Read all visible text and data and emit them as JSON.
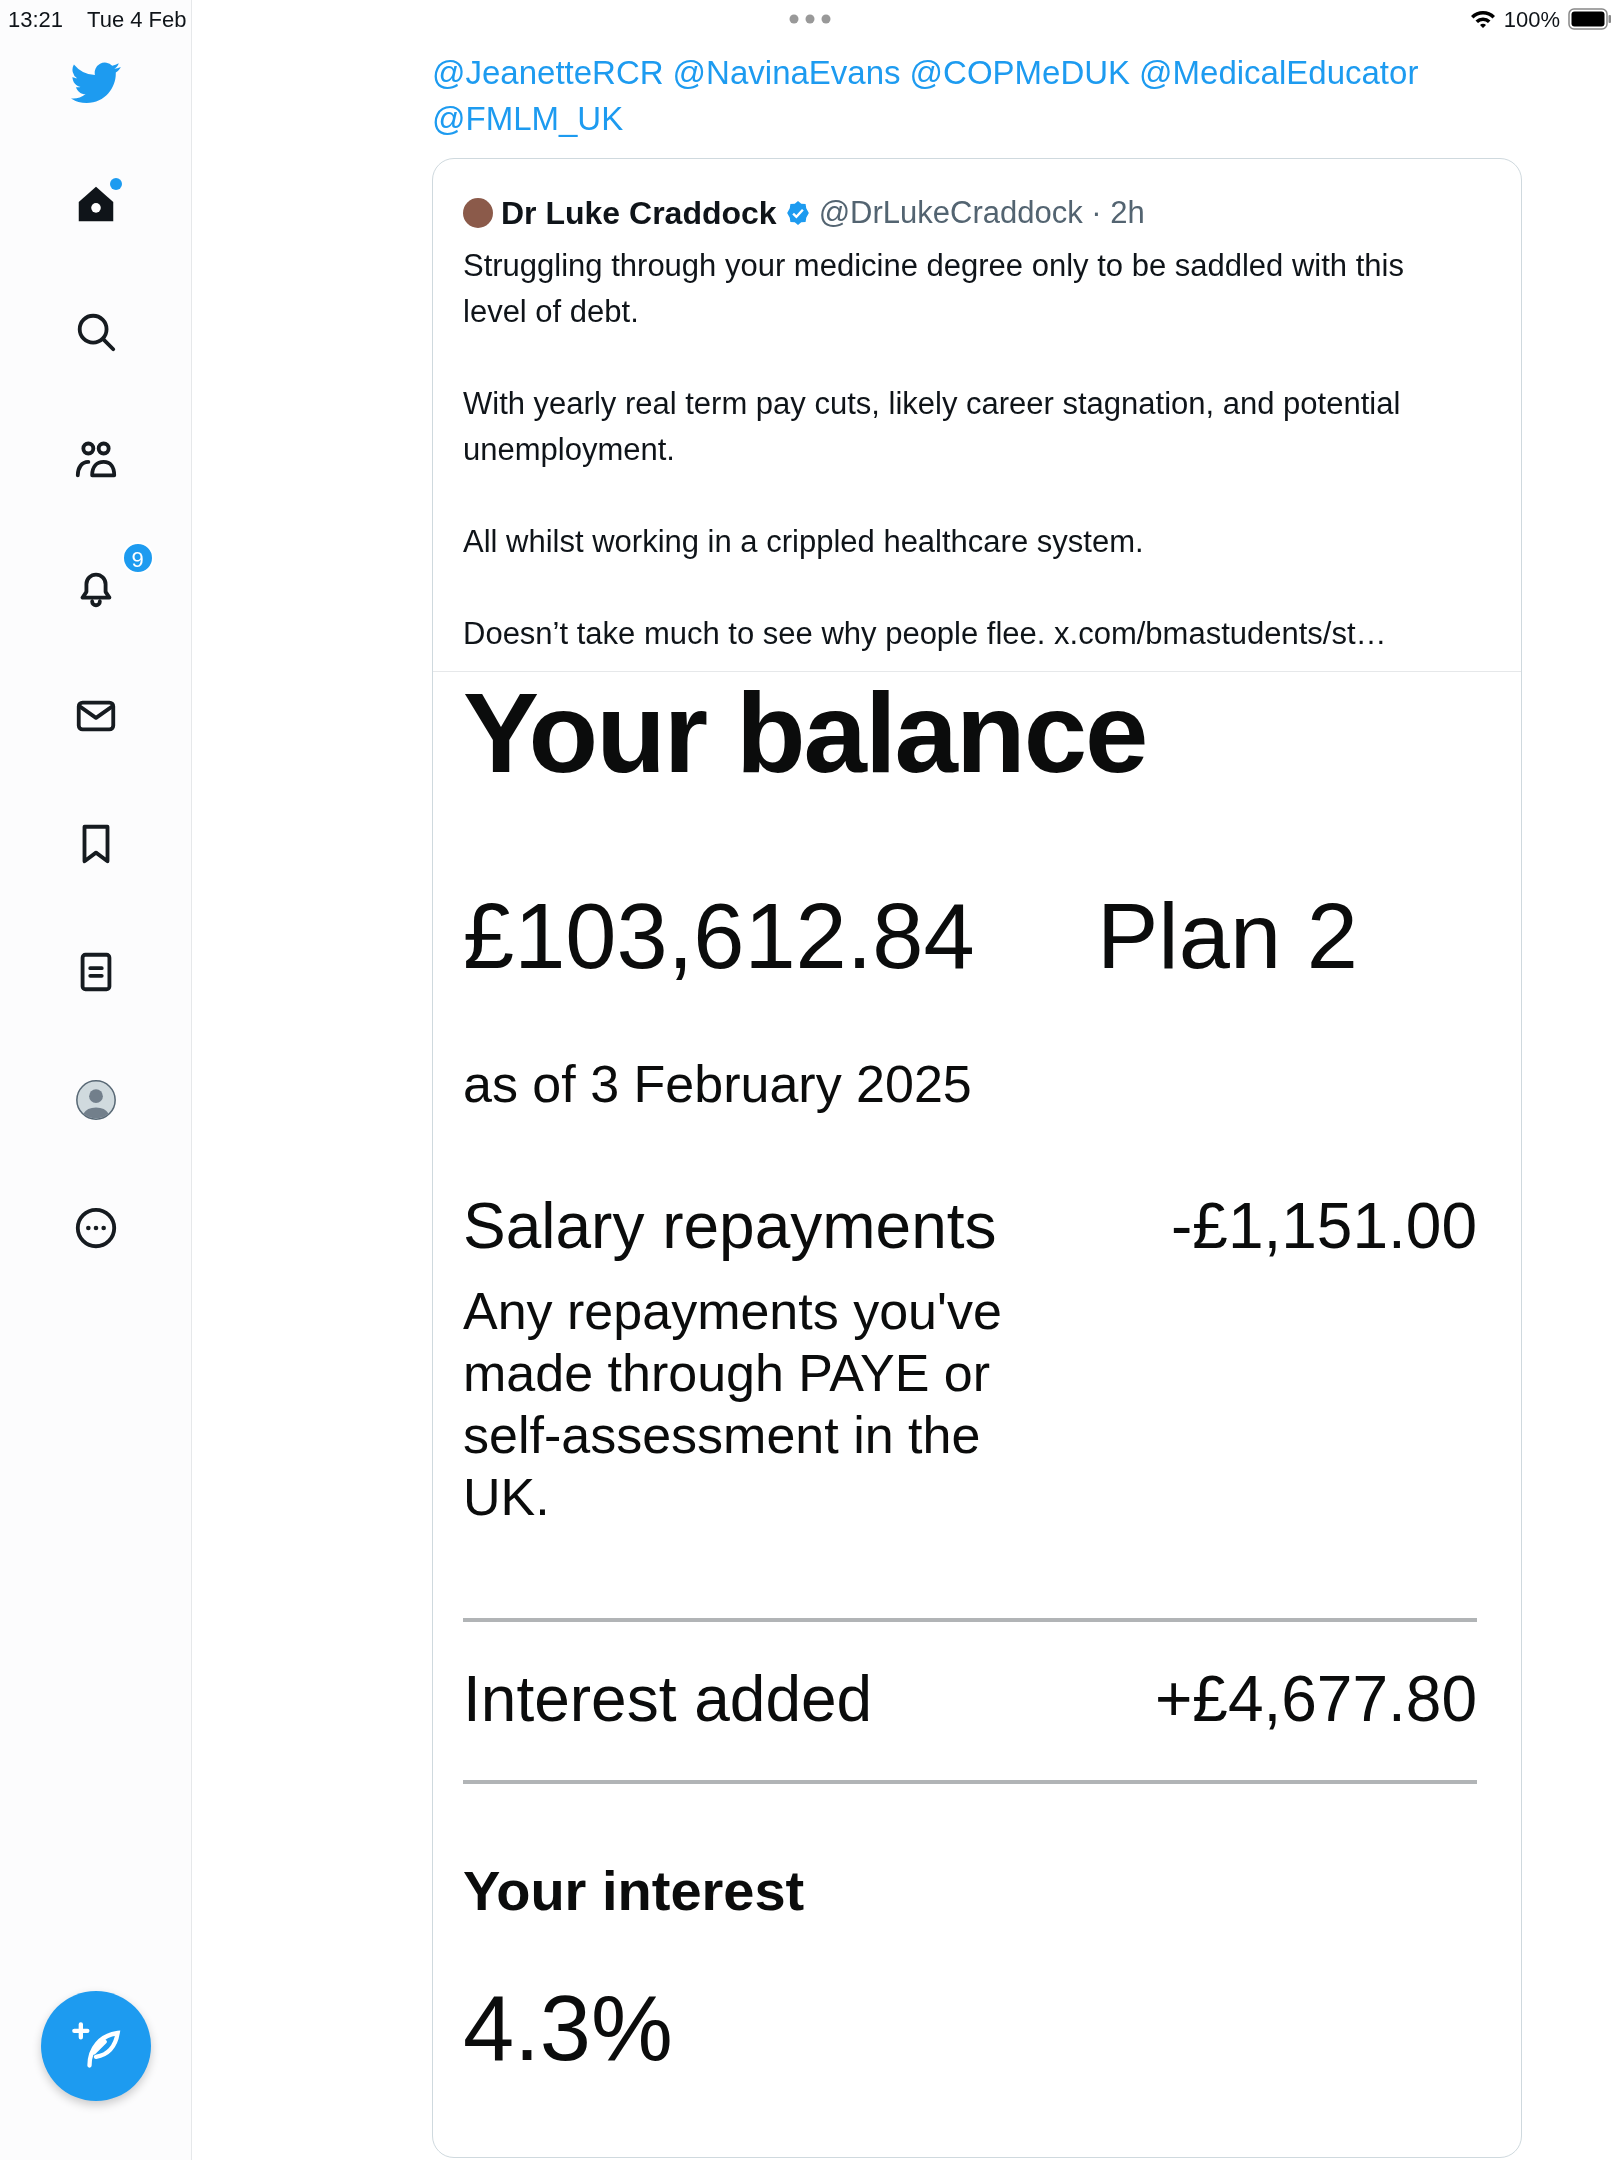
{
  "status_bar": {
    "time": "13:21",
    "date": "Tue 4 Feb",
    "battery": "100%"
  },
  "sidebar": {
    "items": [
      {
        "kind": "home",
        "selected": true,
        "dot": true
      },
      {
        "kind": "search",
        "selected": false
      },
      {
        "kind": "people",
        "selected": false
      },
      {
        "kind": "bell",
        "selected": false,
        "badge": "9"
      },
      {
        "kind": "mail",
        "selected": false
      },
      {
        "kind": "bookmark",
        "selected": false
      },
      {
        "kind": "list",
        "selected": false
      },
      {
        "kind": "profile",
        "selected": false
      },
      {
        "kind": "more",
        "selected": false
      }
    ]
  },
  "reply_to": [
    "@JeanetteRCR",
    "@NavinaEvans",
    "@COPMeDUK",
    "@MedicalEducator",
    "@FMLM_UK"
  ],
  "quoted_tweet": {
    "author": "Dr Luke Craddock",
    "verified": true,
    "handle": "@DrLukeCraddock",
    "time": "· 2h",
    "paragraphs": [
      "Struggling through your medicine degree only to be saddled with this level of debt.",
      "With yearly real term pay cuts, likely career stagnation, and potential unemployment.",
      "All whilst working in a crippled healthcare system.",
      "Doesn’t take much to see why people flee. x.com/bmastudents/st…"
    ],
    "image": {
      "title": "Your balance",
      "balance": "£103,612.84",
      "plan": "Plan 2",
      "as_of": "as of 3 February 2025",
      "repayments_label": "Salary repayments",
      "repayments_value": "-£1,151.00",
      "repayments_note": "Any repayments you've made through PAYE or self-assessment in the UK.",
      "interest_label": "Interest added",
      "interest_value": "+£4,677.80",
      "rate_title": "Your interest",
      "rate": "4.3%"
    }
  }
}
